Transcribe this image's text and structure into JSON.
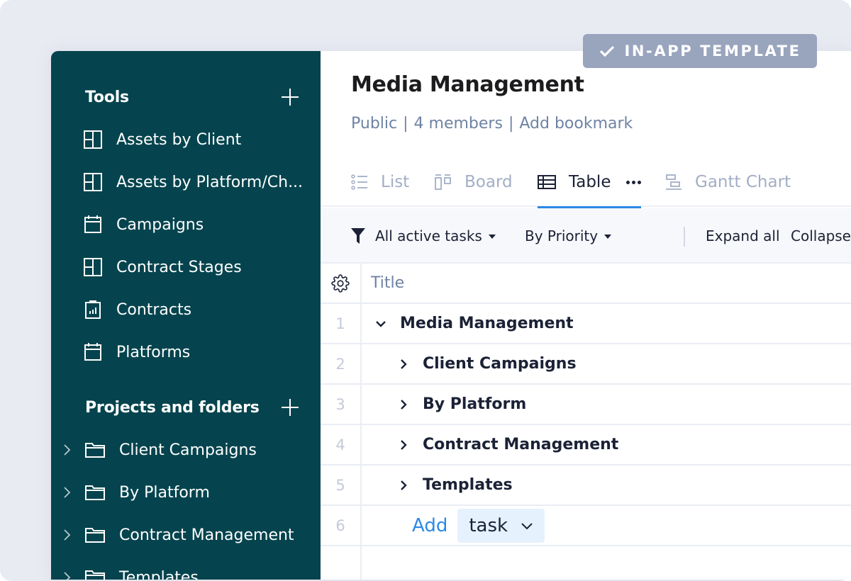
{
  "badge": {
    "label": "IN-APP TEMPLATE",
    "icon": "check-icon"
  },
  "sidebar": {
    "tools": {
      "heading": "Tools",
      "items": [
        {
          "label": "Assets by Client",
          "icon": "board-icon"
        },
        {
          "label": "Assets by Platform/Ch...",
          "icon": "board-icon"
        },
        {
          "label": "Campaigns",
          "icon": "calendar-icon"
        },
        {
          "label": "Contract Stages",
          "icon": "board-icon"
        },
        {
          "label": "Contracts",
          "icon": "report-icon"
        },
        {
          "label": "Platforms",
          "icon": "calendar-icon"
        }
      ]
    },
    "projects": {
      "heading": "Projects and folders",
      "items": [
        {
          "label": "Client Campaigns",
          "icon": "folder-icon"
        },
        {
          "label": "By Platform",
          "icon": "folder-icon"
        },
        {
          "label": "Contract Management",
          "icon": "folder-icon"
        },
        {
          "label": "Templates",
          "icon": "folder-icon"
        }
      ]
    }
  },
  "header": {
    "title": "Media Management",
    "meta": {
      "visibility": "Public",
      "members": "4 members",
      "bookmark": "Add bookmark",
      "separator": "|"
    }
  },
  "tabs": [
    {
      "label": "List",
      "icon": "list-icon",
      "active": false
    },
    {
      "label": "Board",
      "icon": "board-view-icon",
      "active": false
    },
    {
      "label": "Table",
      "icon": "table-icon",
      "active": true
    },
    {
      "label": "Gantt Chart",
      "icon": "gantt-icon",
      "active": false
    }
  ],
  "toolbar": {
    "filter": "All active tasks",
    "sort": "By Priority",
    "expand": "Expand all",
    "collapse": "Collapse all"
  },
  "table": {
    "column_title": "Title",
    "rows": [
      {
        "num": "1",
        "title": "Media Management",
        "expanded": true,
        "level": 0
      },
      {
        "num": "2",
        "title": "Client Campaigns",
        "expanded": false,
        "level": 1
      },
      {
        "num": "3",
        "title": "By Platform",
        "expanded": false,
        "level": 1
      },
      {
        "num": "4",
        "title": "Contract Management",
        "expanded": false,
        "level": 1
      },
      {
        "num": "5",
        "title": "Templates",
        "expanded": false,
        "level": 1
      }
    ],
    "add_row": {
      "num": "6",
      "add_label": "Add",
      "type_label": "task"
    }
  },
  "colors": {
    "sidebar_bg": "#05444e",
    "accent": "#2b8ae6",
    "badge_bg": "#99a4bd",
    "muted_text": "#6e83a3"
  }
}
